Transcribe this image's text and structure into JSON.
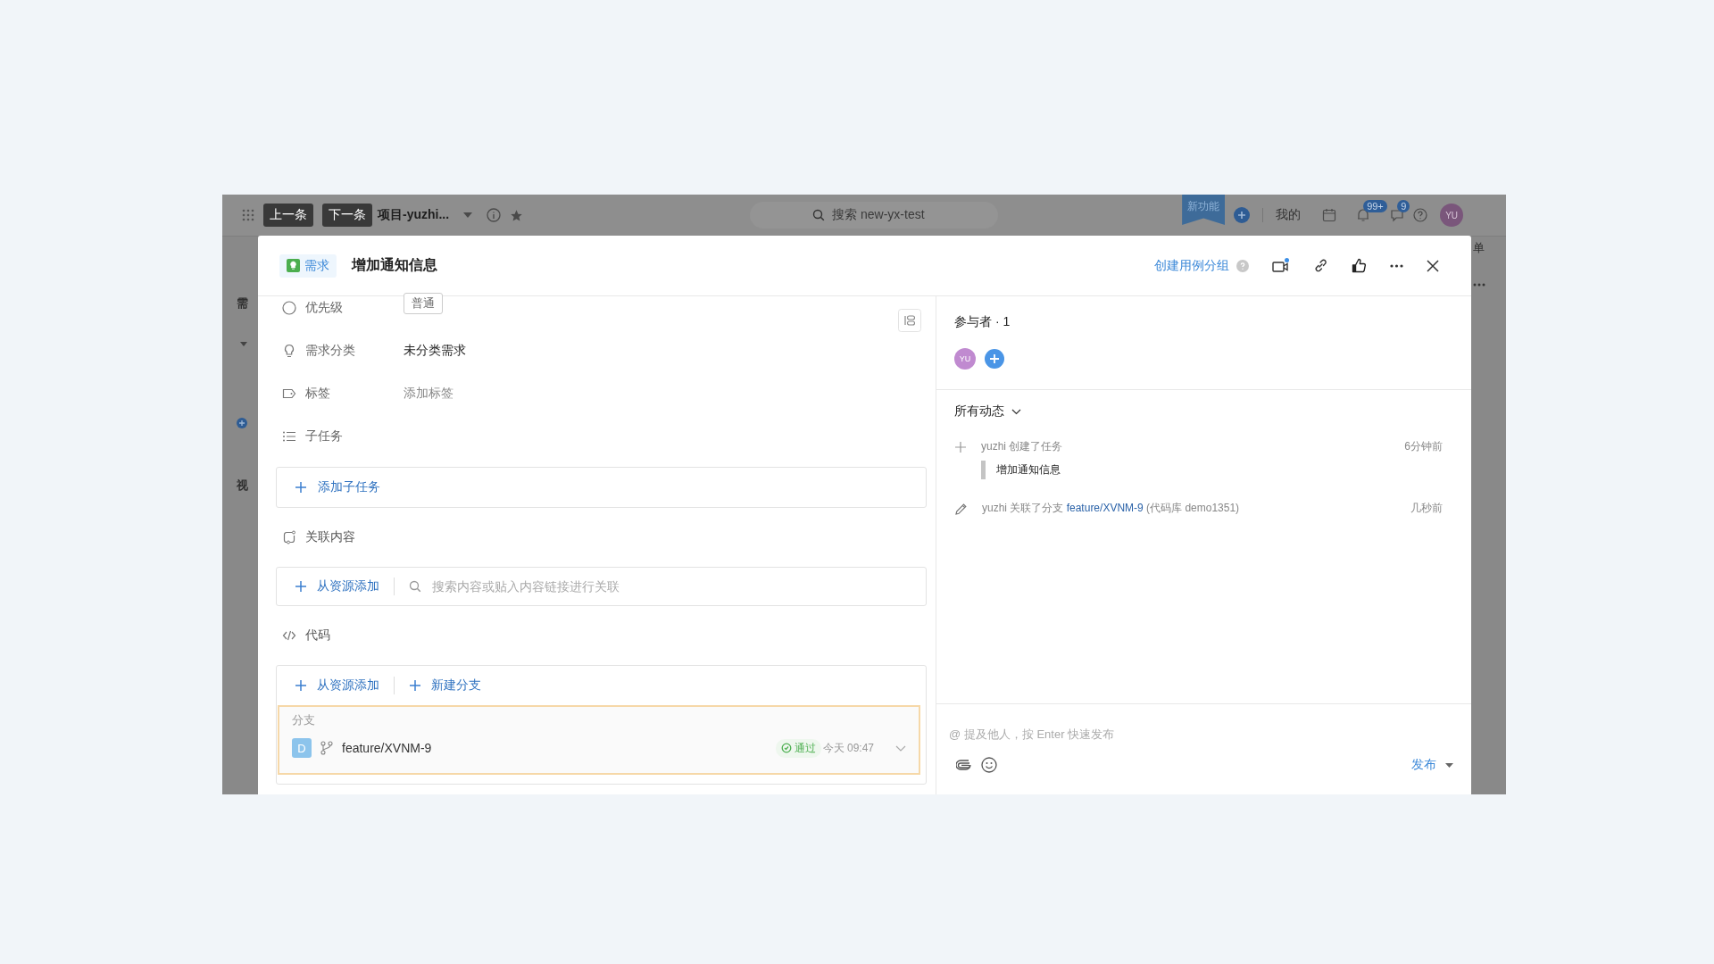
{
  "topbar": {
    "prev_button": "上一条",
    "next_button": "下一条",
    "project": "项目-yuzhi...",
    "search": {
      "placeholder": "搜索 new-yx-test"
    },
    "new_feature": "新功能",
    "mine": "我的",
    "notification_badge": "99+",
    "message_badge": "9",
    "avatar": "YU"
  },
  "background": {
    "left_labels": [
      "需",
      "视"
    ],
    "right_label": "单"
  },
  "modal": {
    "type_tag": "需求",
    "title": "增加通知信息",
    "create_group_link": "创建用例分组"
  },
  "fields": [
    {
      "kind": "priority",
      "label": "优先级",
      "value": "普通"
    },
    {
      "kind": "category",
      "label": "需求分类",
      "value": "未分类需求"
    },
    {
      "kind": "tag",
      "label": "标签",
      "placeholder": "添加标签"
    },
    {
      "kind": "subtask",
      "label": "子任务"
    }
  ],
  "subtask_add": "添加子任务",
  "related": {
    "label": "关联内容",
    "add": "从资源添加",
    "search": {
      "placeholder": "搜索内容或贴入内容链接进行关联"
    }
  },
  "code": {
    "label": "代码",
    "add": "从资源添加",
    "new_branch": "新建分支",
    "section": "分支",
    "branches": [
      {
        "avatar": "D",
        "name": "feature/XVNM-9",
        "status": "通过",
        "time": "今天 09:47"
      }
    ]
  },
  "participants": {
    "title": "参与者 · 1",
    "avatars": [
      "YU"
    ]
  },
  "activity": {
    "filter": "所有动态",
    "items": [
      {
        "kind": "create",
        "text": "yuzhi 创建了任务",
        "quote": "增加通知信息",
        "time": "6分钟前"
      },
      {
        "kind": "edit",
        "text": "yuzhi 关联了分支 ",
        "link": "feature/XVNM-9",
        "suffix": " (代码库 demo1351)",
        "time": "几秒前"
      }
    ]
  },
  "comment": {
    "placeholder": "@ 提及他人，按 Enter 快速发布",
    "publish": "发布"
  }
}
